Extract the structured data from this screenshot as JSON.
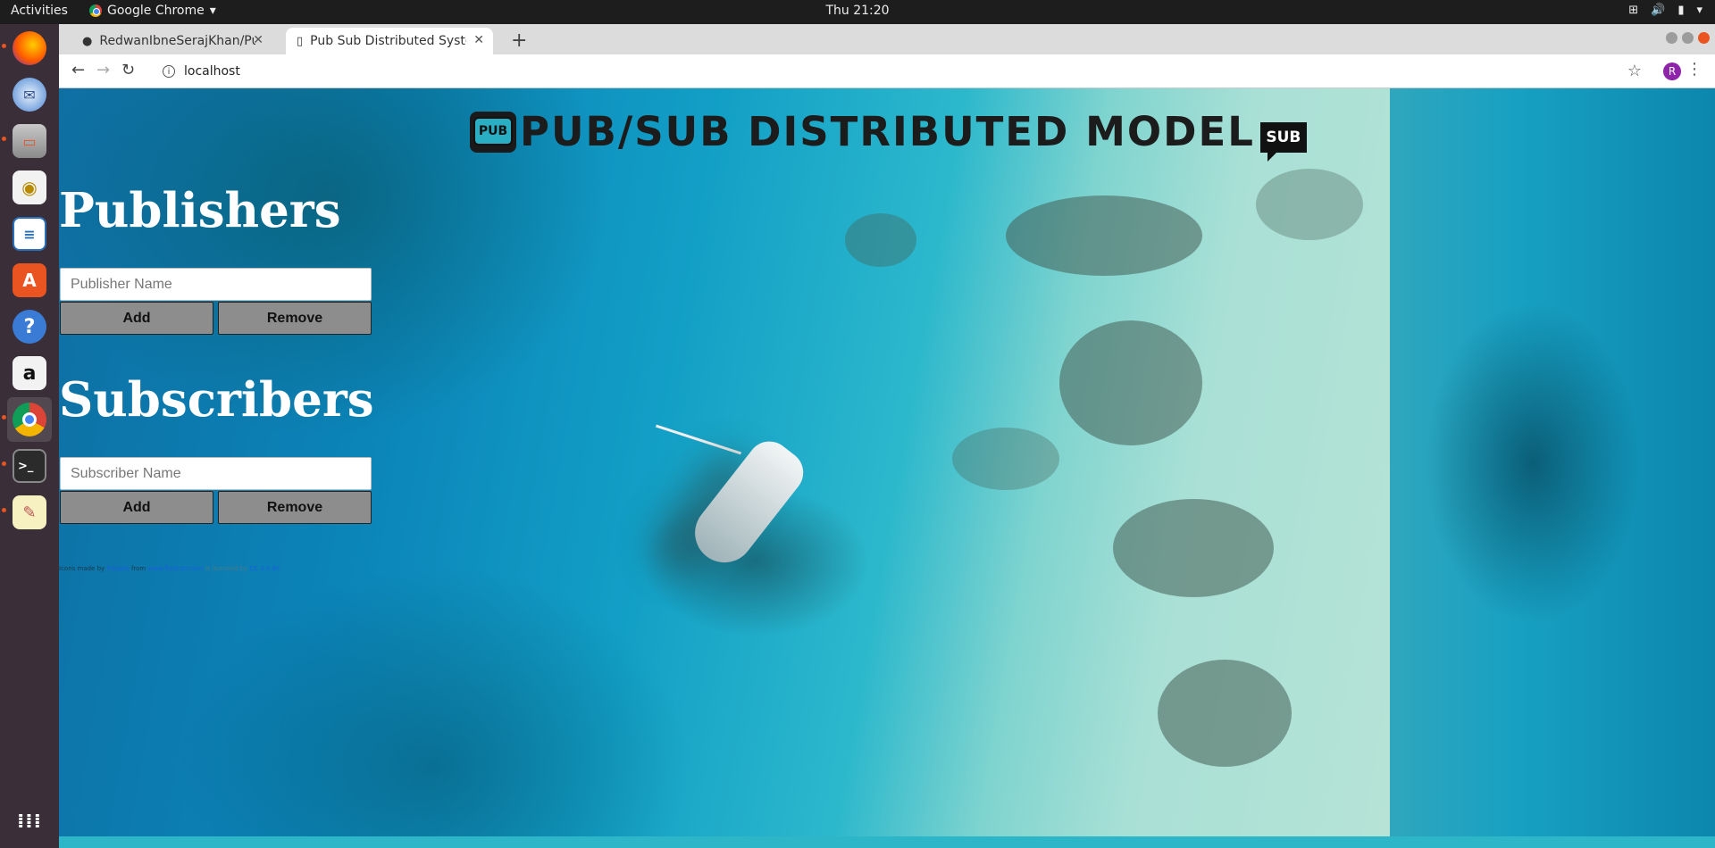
{
  "topbar": {
    "activities": "Activities",
    "app_name": "Google Chrome",
    "clock": "Thu 21:20"
  },
  "dock": {
    "items": [
      {
        "name": "firefox-icon",
        "running": true
      },
      {
        "name": "thunderbird-icon",
        "running": false
      },
      {
        "name": "files-icon",
        "running": true
      },
      {
        "name": "rhythmbox-icon",
        "running": false
      },
      {
        "name": "libreoffice-writer-icon",
        "running": false
      },
      {
        "name": "software-center-icon",
        "running": false
      },
      {
        "name": "help-icon",
        "running": false
      },
      {
        "name": "amazon-icon",
        "running": false
      },
      {
        "name": "chrome-icon",
        "running": true
      },
      {
        "name": "terminal-icon",
        "running": true
      },
      {
        "name": "text-editor-icon",
        "running": true
      }
    ],
    "show_apps": "show-applications-icon"
  },
  "browser": {
    "tabs": [
      {
        "title": "RedwanIbneSerajKhan/Pu",
        "active": false
      },
      {
        "title": "Pub Sub Distributed Syste",
        "active": true
      }
    ],
    "address": "localhost",
    "profile_initial": "R"
  },
  "page": {
    "header": {
      "pub_icon_label": "PUB",
      "title": "PUB/SUB DISTRIBUTED MODEL",
      "sub_icon_label": "SUB"
    },
    "publishers": {
      "title": "Publishers",
      "input_placeholder": "Publisher Name",
      "add_label": "Add",
      "remove_label": "Remove"
    },
    "subscribers": {
      "title": "Subscribers",
      "input_placeholder": "Subscriber Name",
      "add_label": "Add",
      "remove_label": "Remove"
    },
    "credit": {
      "prefix": "Icons made by",
      "author": "Freepik",
      "from": "from",
      "site": "www.flaticon.com",
      "licensed": "is licensed by",
      "license": "CC 3.0 BY"
    }
  }
}
